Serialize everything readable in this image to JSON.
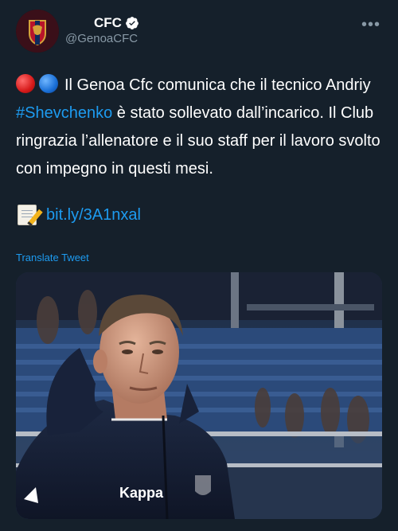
{
  "header": {
    "display_name": "CFC",
    "handle": "@GenoaCFC",
    "more_icon": "more-horizontal-icon",
    "verified_icon": "verified-badge-icon"
  },
  "tweet": {
    "text_before_hashtag": "Il Genoa Cfc comunica che il tecnico Andriy ",
    "hashtag": "#Shevchenko",
    "text_after_hashtag": " è stato sollevato dall’incarico. Il Club ringrazia l’allenatore e il suo staff per il lavoro svolto con impegno in questi mesi.",
    "link_icon": "memo-icon",
    "link": "bit.ly/3A1nxal"
  },
  "translate": "Translate Tweet",
  "photo": {
    "jacket_brand": "Kappa"
  },
  "colors": {
    "background": "#15202b",
    "link": "#1d9bf0",
    "secondary_text": "#8899a6"
  }
}
